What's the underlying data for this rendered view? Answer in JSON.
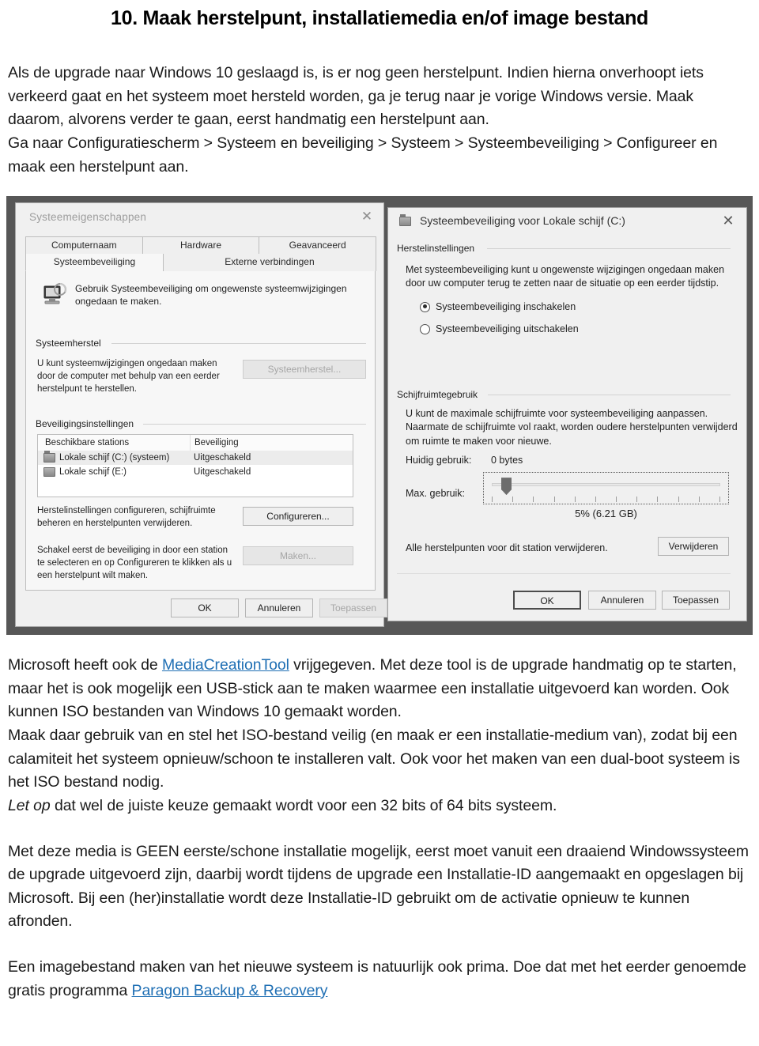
{
  "document": {
    "title": "10. Maak herstelpunt, installatiemedia en/of  image bestand",
    "intro_paragraph": "Als de upgrade naar Windows 10 geslaagd is, is er nog geen herstelpunt. Indien hierna onverhoopt iets verkeerd gaat en het systeem moet hersteld worden, ga  je terug naar je vorige Windows versie. Maak daarom, alvorens verder te gaan, eerst handmatig een herstelpunt aan.",
    "path_paragraph": "Ga naar  Configuratiescherm > Systeem en beveiliging > Systeem > Systeembeveiliging > Configureer en maak een herstelpunt aan.",
    "para_mct_1": "Microsoft heeft ook de ",
    "link_mct": "MediaCreationTool",
    "para_mct_2": " vrijgegeven. Met deze tool is de upgrade handmatig op te starten, maar het is ook mogelijk een USB-stick aan te maken waarmee een installatie  uitgevoerd kan worden. Ook kunnen ISO bestanden van Windows 10 gemaakt worden.",
    "para_iso": "Maak daar gebruik van en stel het ISO-bestand veilig (en maak er een installatie-medium van), zodat bij een calamiteit het systeem opnieuw/schoon te installeren valt. Ook voor het maken van een dual-boot systeem is het ISO bestand nodig.",
    "note_emphasis": "Let op",
    "note_rest": " dat wel de juiste keuze gemaakt wordt voor een 32 bits of 64 bits systeem.",
    "para_media": "Met deze media is GEEN eerste/schone installatie mogelijk, eerst moet vanuit een draaiend Windowssysteem de upgrade uitgevoerd zijn, daarbij wordt tijdens de upgrade een Installatie-ID aangemaakt en opgeslagen bij Microsoft. Bij een (her)installatie wordt deze Installatie-ID gebruikt om de activatie opnieuw te kunnen afronden.",
    "para_image_1": "Een imagebestand maken van het nieuwe systeem is natuurlijk ook prima. Doe dat met het eerder genoemde gratis programma ",
    "link_paragon": "Paragon Backup & Recovery",
    "link_color": "#1f6fb4"
  },
  "screenshot": {
    "left_dialog": {
      "title": "Systeemeigenschappen",
      "close_icon": "✕",
      "tabs_row1": [
        "Computernaam",
        "Hardware",
        "Geavanceerd"
      ],
      "tabs_row2": [
        "Systeembeveiliging",
        "Externe verbindingen"
      ],
      "selected_tab": "Systeembeveiliging",
      "header_text": "Gebruik Systeembeveiliging om ongewenste systeemwijzigingen ongedaan te maken.",
      "group_systeemherstel": "Systeemherstel",
      "systeemherstel_text": "U kunt systeemwijzigingen ongedaan maken door de computer met behulp van een eerder herstelpunt te herstellen.",
      "btn_systeemherstel": "Systeemherstel...",
      "group_beveiliging": "Beveiligingsinstellingen",
      "list_headers": [
        "Beschikbare stations",
        "Beveiliging"
      ],
      "list_rows": [
        {
          "drive": "Lokale schijf (C:) (systeem)",
          "status": "Uitgeschakeld",
          "is_system": true
        },
        {
          "drive": "Lokale schijf (E:)",
          "status": "Uitgeschakeld",
          "is_system": false
        }
      ],
      "configureer_text": "Herstelinstellingen configureren, schijfruimte beheren en herstelpunten verwijderen.",
      "btn_configureren": "Configureren...",
      "maken_text": "Schakel eerst de beveiliging in door een station te selecteren en op Configureren te klikken als u een herstelpunt wilt maken.",
      "btn_maken": "Maken...",
      "btn_ok": "OK",
      "btn_annuleren": "Annuleren",
      "btn_toepassen": "Toepassen"
    },
    "right_dialog": {
      "title": "Systeembeveiliging voor Lokale schijf (C:)",
      "close_icon": "✕",
      "group_herstelinstellingen": "Herstelinstellingen",
      "herstel_text": "Met systeembeveiliging kunt u ongewenste wijzigingen ongedaan maken door uw computer terug te zetten naar de situatie op een eerder tijdstip.",
      "radio_on_label": "Systeembeveiliging inschakelen",
      "radio_off_label": "Systeembeveiliging uitschakelen",
      "radio_selected": "Systeembeveiliging inschakelen",
      "group_schijfruimte": "Schijfruimtegebruik",
      "schijf_text": "U kunt de maximale schijfruimte voor systeembeveiliging aanpassen. Naarmate de schijfruimte vol raakt, worden oudere herstelpunten verwijderd om ruimte te maken voor nieuwe.",
      "huidig_label": "Huidig gebruik:",
      "huidig_value": "0 bytes",
      "max_label": "Max. gebruik:",
      "slider_value_label": "5% (6.21 GB)",
      "slider_percent": 5,
      "delete_text": "Alle herstelpunten voor dit station verwijderen.",
      "btn_verwijderen": "Verwijderen",
      "btn_ok": "OK",
      "btn_annuleren": "Annuleren",
      "btn_toepassen": "Toepassen"
    }
  }
}
